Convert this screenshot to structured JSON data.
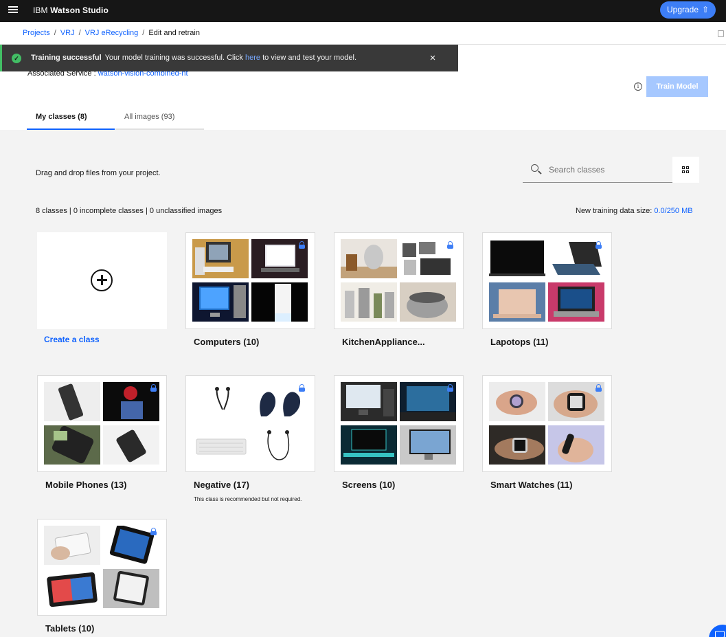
{
  "app": {
    "brand_prefix": "IBM",
    "brand_name": "Watson Studio",
    "upgrade_label": "Upgrade",
    "upgrade_icon": "⇧"
  },
  "breadcrumb": {
    "items": [
      "Projects",
      "VRJ",
      "VRJ eRecycling"
    ],
    "current": "Edit and retrain"
  },
  "toast": {
    "title": "Training successful",
    "message_before": "Your model training was successful. Click",
    "link": "here",
    "message_after": "to view and test your model.",
    "close_icon": "×",
    "color": "#42be65"
  },
  "header": {
    "associated_label": "Associated Service :",
    "associated_value": "watson-vision-combined-nt",
    "info_icon": "i",
    "train_button": "Train Model"
  },
  "tabs": [
    {
      "label": "My classes (8)",
      "active": true
    },
    {
      "label": "All images (93)",
      "active": false
    }
  ],
  "content": {
    "drag_text": "Drag and drop files from your project.",
    "search_placeholder": "Search classes",
    "stats": "8 classes | 0 incomplete classes | 0 unclassified images",
    "size_label": "New training data size:",
    "size_value": "0.0/250 MB",
    "create_label": "Create a class"
  },
  "classes": [
    {
      "label": "Computers (10)"
    },
    {
      "label": "KitchenAppliance..."
    },
    {
      "label": "Lapotops (11)"
    },
    {
      "label": "Mobile Phones (13)"
    },
    {
      "label": "Negative (17)",
      "note": "This class is recommended but not required."
    },
    {
      "label": "Screens (10)"
    },
    {
      "label": "Smart Watches (11)"
    },
    {
      "label": "Tablets (10)"
    }
  ],
  "colors": {
    "accent": "#0f62fe",
    "topbar": "#161616",
    "train_button_disabled": "#a6c8ff",
    "upgrade": "#3d7ef6"
  }
}
